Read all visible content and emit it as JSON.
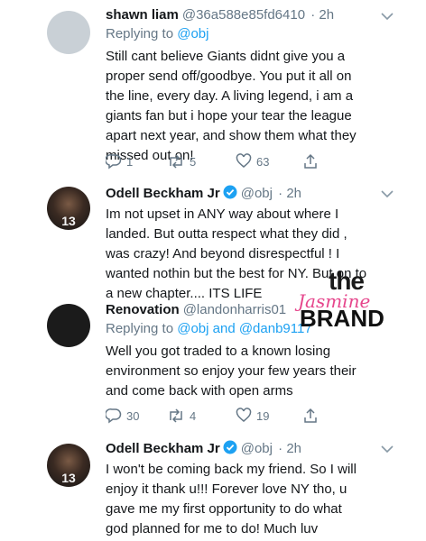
{
  "tweets": [
    {
      "name": "shawn liam",
      "handle": "@36a588e85fd6410",
      "time": "· 2h",
      "reply_prefix": "Replying to",
      "reply_to": "@obj",
      "body": "Still cant believe Giants didnt give you a proper send off/goodbye. You put it all on the line, every day. A living legend, i am a giants fan but i hope your tear the league apart next year, and show them what they missed out on!",
      "replies": "1",
      "retweets": "5",
      "likes": "63"
    },
    {
      "name": "Odell Beckham Jr",
      "handle": "@obj",
      "time": "· 2h",
      "avatar_text": "13",
      "body": "Im not upset in ANY way about where I landed. But outta respect what they did , was crazy! And beyond disrespectful ! I wanted nothin but the best for NY. But on to a new chapter.... ITS LIFE"
    },
    {
      "name": "Renovation",
      "handle": "@landonharris01",
      "time": "· 2h",
      "reply_prefix": "Replying to",
      "reply_to": "@obj and @danb9117",
      "body": "Well you got traded to a known losing environment so enjoy your few years their and come back with open arms",
      "replies": "30",
      "retweets": "4",
      "likes": "19"
    },
    {
      "name": "Odell Beckham Jr",
      "handle": "@obj",
      "time": "· 2h",
      "avatar_text": "13",
      "body": "I won't be coming back my friend. So I will enjoy it thank u!!! Forever love NY tho, u gave me my first opportunity to do what god planned for me to do! Much luv"
    }
  ],
  "watermark": {
    "line1": "the",
    "line2": "Jasmine",
    "line3": "BRAND"
  },
  "colors": {
    "link": "#1da1f2",
    "secondary": "#657786",
    "verified": "#1da1f2",
    "watermark_accent": "#e6468c"
  },
  "icons": [
    "reply-icon",
    "retweet-icon",
    "like-icon",
    "share-icon",
    "verified-badge-icon",
    "chevron-down-icon"
  ]
}
